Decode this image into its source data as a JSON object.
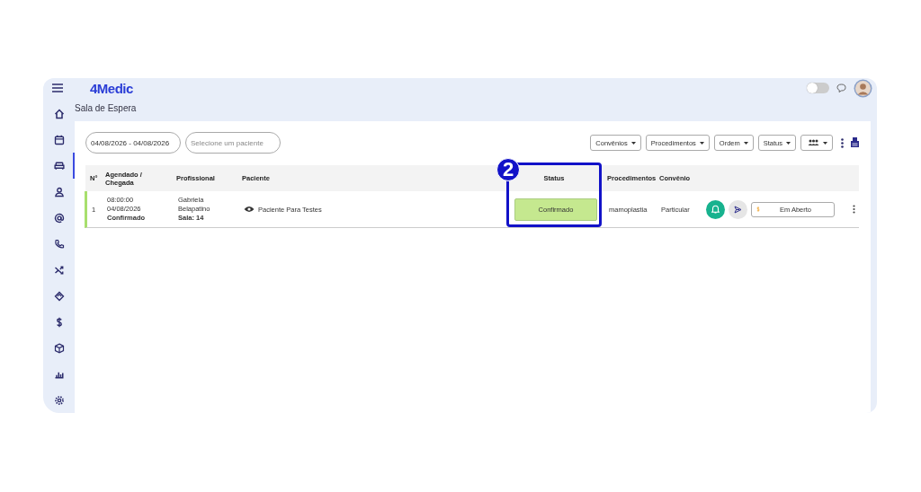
{
  "brand": "4Medic",
  "header": {
    "toggle": {
      "on": false
    }
  },
  "sidebar": {
    "items": [
      {
        "selected": false
      },
      {
        "selected": false
      },
      {
        "selected": true
      },
      {
        "selected": false
      },
      {
        "selected": false
      },
      {
        "selected": false
      },
      {
        "selected": false
      },
      {
        "selected": false
      },
      {
        "selected": false
      },
      {
        "selected": false
      },
      {
        "selected": false
      },
      {
        "selected": false
      }
    ]
  },
  "page_title": "Sala de Espera",
  "filters": {
    "date_range": "04/08/2026 - 04/08/2026",
    "patient": {
      "placeholder": "Selecione um paciente"
    }
  },
  "dropdowns": [
    {
      "kind": "text",
      "label": "Convênios"
    },
    {
      "kind": "text",
      "label": "Procedimentos"
    },
    {
      "kind": "text",
      "label": "Ordem"
    },
    {
      "kind": "text",
      "label": "Status"
    },
    {
      "kind": "icon"
    }
  ],
  "table": {
    "columns": [
      "N°",
      "Agendado / Chegada",
      "Profissional",
      "Paciente",
      "Status",
      "Procedimentos",
      "Convênio"
    ],
    "rows": [
      {
        "number": "1",
        "scheduled": "08:00:00",
        "date": "04/08/2026",
        "arrival_status": "Confirmado",
        "professional": "Gabriela Belapatino",
        "room": "Sala: 14",
        "patient": "Paciente Para Testes",
        "status": "Confirmado",
        "procedure": "mamoplastia",
        "insurance": "Particular",
        "payment": "Em Aberto"
      }
    ]
  },
  "annotation": {
    "label": "2"
  }
}
